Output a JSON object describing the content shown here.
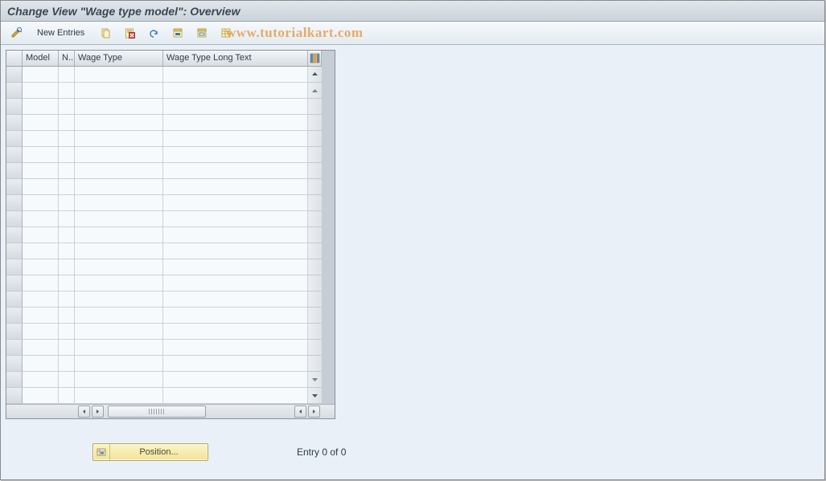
{
  "title": "Change View \"Wage type model\": Overview",
  "watermark": "www.tutorialkart.com",
  "toolbar": {
    "new_entries_label": "New Entries"
  },
  "table": {
    "columns": {
      "model": "Model",
      "n": "N..",
      "wage_type": "Wage Type",
      "wage_type_long_text": "Wage Type Long Text"
    },
    "row_count": 21
  },
  "footer": {
    "position_label": "Position...",
    "entry_text": "Entry 0 of 0"
  }
}
